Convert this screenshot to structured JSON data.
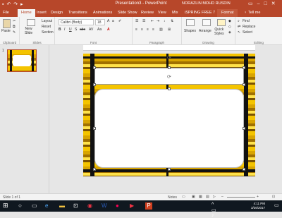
{
  "titlebar": {
    "title": "Presentation3 - PowerPoint",
    "user": "NORAZLIN MOHD RUSDIN",
    "qat_icons": [
      "save-icon",
      "undo-icon",
      "redo-icon",
      "start-from-beginning-icon"
    ]
  },
  "tabs": [
    "File",
    "Home",
    "Insert",
    "Design",
    "Transitions",
    "Animations",
    "Slide Show",
    "Review",
    "View",
    "Mix",
    "iSPRING FREE 7",
    "Format"
  ],
  "tell_me": "Tell me",
  "ribbon": {
    "paste": "Paste",
    "clipboard": "Clipboard",
    "new_slide": "New\nSlide",
    "layout": "Layout",
    "reset": "Reset",
    "section": "Section",
    "slides": "Slides",
    "font_name": "Calibri (Body)",
    "font_size": "18",
    "font": "Font",
    "paragraph": "Paragraph",
    "shapes": "Shapes",
    "arrange": "Arrange",
    "quick_styles": "Quick\nStyles",
    "drawing": "Drawing",
    "find": "Find",
    "replace": "Replace",
    "select": "Select",
    "editing": "Editing"
  },
  "thumbnail": {
    "number": "1"
  },
  "status": {
    "slide": "Slide 1 of 1",
    "notes": "Notes",
    "zoom": "+"
  },
  "taskbar": {
    "time": "4:11 PM",
    "date": "3/26/2017"
  },
  "colors": {
    "accent": "#b7472a",
    "frame_yellow": "#f4c400",
    "frame_dark": "#1a1a1a"
  }
}
